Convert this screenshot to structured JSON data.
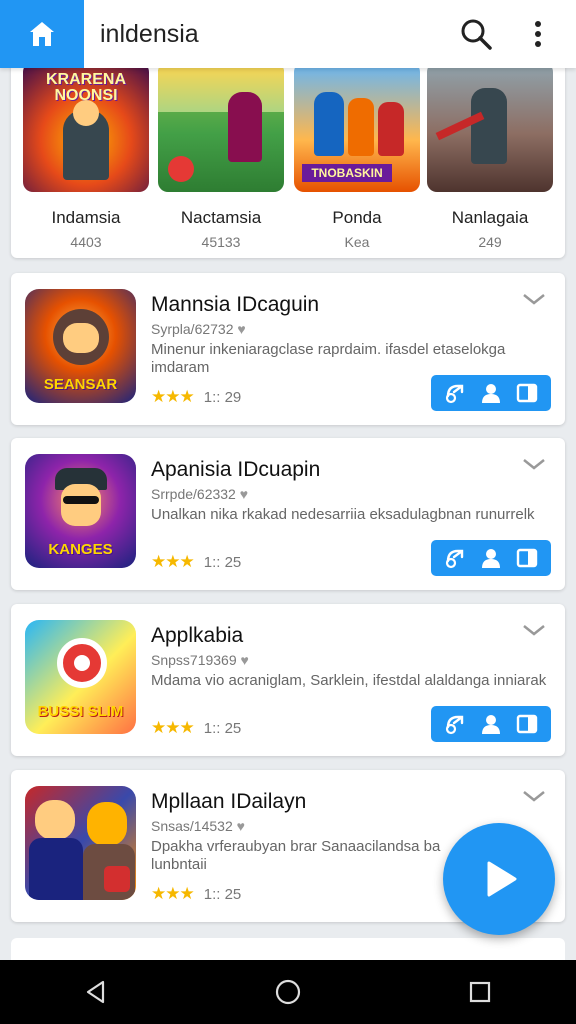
{
  "header": {
    "title": "inldensia",
    "icons": {
      "home": "home-icon",
      "search": "search-icon",
      "menu": "more-vert-icon"
    }
  },
  "featured": [
    {
      "name": "Indamsia",
      "count": "4403",
      "thumb_text": "KRARENA NOONSI"
    },
    {
      "name": "Nactamsia",
      "count": "45133",
      "thumb_text": ""
    },
    {
      "name": "Ponda",
      "count": "Kea",
      "thumb_text": "TNOBASKIN"
    },
    {
      "name": "Nanlagaia",
      "count": "249",
      "thumb_text": ""
    }
  ],
  "apps": [
    {
      "title": "Mannsia IDcaguin",
      "sub": "Syrpla/62732",
      "desc": "Minenur inkeniaragclase raprdaim. ifasdel etaselokga imdaram",
      "rating": "1:: 29",
      "icon_text": "SEANSAR"
    },
    {
      "title": "Apanisia IDcuapin",
      "sub": "Srrpde/62332",
      "desc": "Unalkan nika rkakad nedesarriia eksadulagbnan runurrelk",
      "rating": "1:: 25",
      "icon_text": "KANGES"
    },
    {
      "title": "Applkabia",
      "sub": "Snpss719369",
      "desc": "Mdama vio acraniglam, Sarklein, ifestdal alaldanga inniarak",
      "rating": "1:: 25",
      "icon_text": "BUSSI SLIM"
    },
    {
      "title": "Mpllaan IDailayn",
      "sub": "Snsas/14532",
      "desc": "Dpakha vrferaubyan brar Sanaacilandsa ba lunbntaii",
      "rating": "1:: 25",
      "icon_text": ""
    }
  ],
  "stars": "★★★",
  "colors": {
    "accent": "#2196f3",
    "star": "#f6b800"
  },
  "navbar": {
    "back": "back-icon",
    "home": "home-circle-icon",
    "recents": "recents-icon"
  }
}
